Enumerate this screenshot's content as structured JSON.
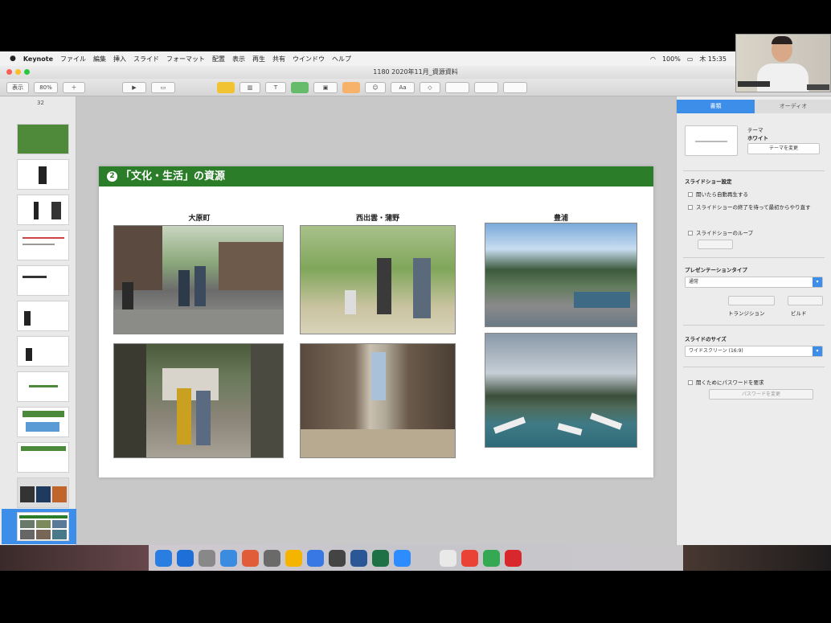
{
  "menubar": {
    "app": "Keynote",
    "items": [
      "ファイル",
      "編集",
      "挿入",
      "スライド",
      "フォーマット",
      "配置",
      "表示",
      "再生",
      "共有",
      "ウインドウ",
      "ヘルプ"
    ],
    "battery": "100%",
    "clock": "木 15:35"
  },
  "window": {
    "title": "1180 2020年11月_資源資料"
  },
  "toolbar": {
    "view_label": "表示",
    "zoom_label": "80%"
  },
  "navigator": {
    "header": "32"
  },
  "slide": {
    "number_badge": "2",
    "title": "「文化・生活」の資源",
    "columns": [
      "大原町",
      "西出雲・蒲野",
      "豊浦"
    ]
  },
  "inspector": {
    "tabs": [
      "書類",
      "オーディオ"
    ],
    "theme_label": "テーマ",
    "theme_value": "ホワイト",
    "change_theme_button": "テーマを変更",
    "slideshow_section": "スライドショー設定",
    "slideshow_options": [
      "開いたら自動再生する",
      "スライドショーの終了を待って最初からやり直す",
      "スライドショーのループ"
    ],
    "presentation_type_section": "プレゼンテーションタイプ",
    "presentation_type_value": "通常",
    "transitions_label": "トランジション",
    "builds_label": "ビルド",
    "slide_size_section": "スライドのサイズ",
    "slide_size_value": "ワイドスクリーン (16:9)",
    "password_option": "開くためにパスワードを要求",
    "change_password_button": "パスワードを変更"
  },
  "dock": {
    "colors": [
      "#2a7de1",
      "#1e6fd8",
      "#888888",
      "#3b8be0",
      "#e15d3a",
      "#6a6a6a",
      "#f4b400",
      "#3778e5",
      "#444444",
      "#2b5797",
      "#1e7145",
      "#2d8cff",
      "#e9e9e9",
      "#ea4335",
      "#34a853",
      "#d9272e"
    ]
  },
  "colors": {
    "slide_header": "#2c7d2a",
    "inspector_tab_active": "#3d8ee8"
  }
}
